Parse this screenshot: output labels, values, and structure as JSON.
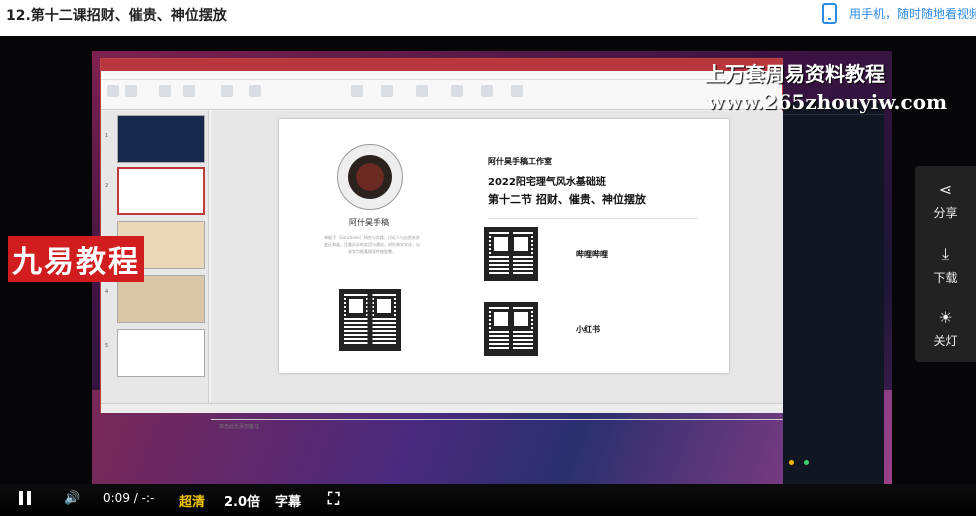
{
  "page": {
    "title": "12.第十二课招财、催贵、神位摆放",
    "mobile_text": "用手机，随时随地看视频"
  },
  "video": {
    "watermark_line1": "上万套周易资料教程",
    "watermark_line2": "www.265zhouyiw.com",
    "brand_sticker": "九易教程",
    "slide": {
      "author": "阿什昊手稿",
      "bio": "坤能子（Sanchime）研究与实践，讨论人与自然关系变迁和谐，注重风水的实用与建议，研究易学文化，以易学为根基倡导传统智慧。",
      "studio": "阿什昊手稿工作室",
      "course": "2022阳宅理气风水基础班",
      "lesson": "第十二节 招财、催贵、神位摆放",
      "qr1_label": "哔哩哔哩",
      "qr2_label": "小红书"
    },
    "notes_placeholder": "单击此处添加备注"
  },
  "side_panel": {
    "share": "分享",
    "download": "下载",
    "lights_off": "关灯"
  },
  "controls": {
    "current_time": "0:09",
    "separator": "/",
    "duration": "-:-",
    "quality": "超清",
    "speed": "2.0倍",
    "subtitles": "字幕"
  }
}
